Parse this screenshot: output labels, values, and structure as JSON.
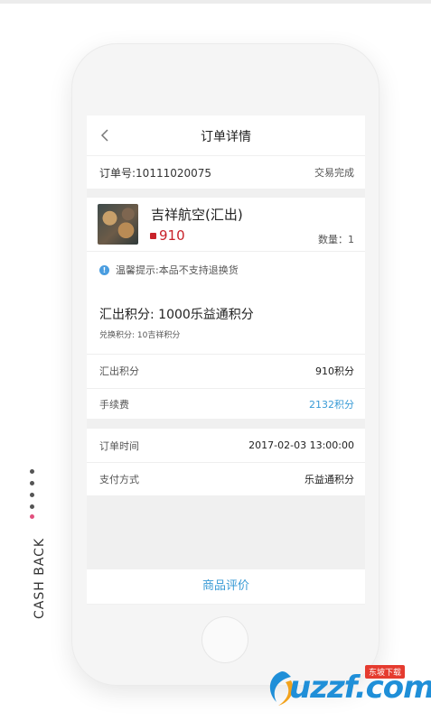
{
  "nav": {
    "title": "订单详情"
  },
  "order": {
    "number": "订单号:10111020075",
    "status": "交易完成"
  },
  "product": {
    "name": "吉祥航空(汇出)",
    "price": "910",
    "quantity": "数量：1",
    "tip": "温馨提示:本品不支持退换货"
  },
  "points": {
    "title": "汇出积分: 1000乐益通积分",
    "subtitle": "兑换积分: 10吉祥积分",
    "rows": [
      {
        "label": "汇出积分",
        "value": "910积分"
      },
      {
        "label": "手续费",
        "value": "2132积分"
      }
    ]
  },
  "details": {
    "rows": [
      {
        "label": "订单时间",
        "value": "2017-02-03 13:00:00"
      },
      {
        "label": "支付方式",
        "value": "乐益通积分"
      }
    ]
  },
  "review_button": "商品评价",
  "side": {
    "text": "CASH BACK"
  },
  "watermark": {
    "brand": "uzzf.com",
    "badge": "东坡下载"
  },
  "colors": {
    "accent": "#3a9bd6",
    "price": "#c8222a",
    "active_dot": "#e2507e"
  }
}
